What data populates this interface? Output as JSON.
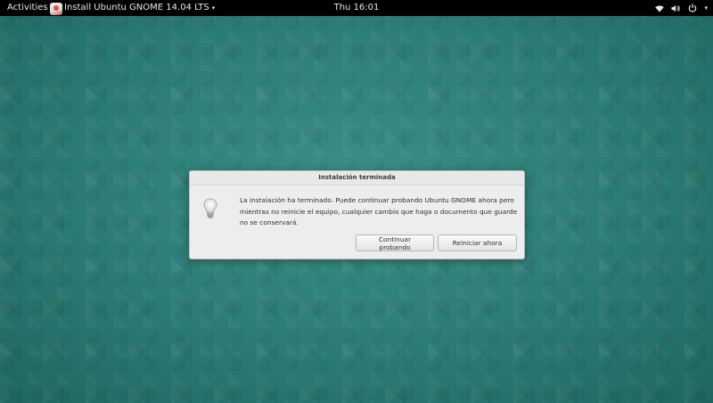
{
  "topbar": {
    "activities_label": "Activities",
    "app_menu_label": "Install Ubuntu GNOME 14.04 LTS",
    "app_menu_chevron": "▾",
    "clock": "Thu 16:01",
    "status_icons": [
      "wifi-icon",
      "volume-icon",
      "power-icon"
    ],
    "power_chevron": "▾"
  },
  "dialog": {
    "title": "Instalación terminada",
    "icon": "lightbulb-icon",
    "message": "La instalación ha terminado. Puede continuar probando Ubuntu GNOME ahora pero mientras no reinicie el equipo, cualquier cambio que haga o documento que guarde no se conservará.",
    "buttons": {
      "continue_label": "Continuar probando",
      "restart_label": "Reiniciar ahora"
    }
  },
  "colors": {
    "topbar_bg": "#000000",
    "desktop_bg": "#2a7a74",
    "dialog_bg": "#ededed"
  }
}
